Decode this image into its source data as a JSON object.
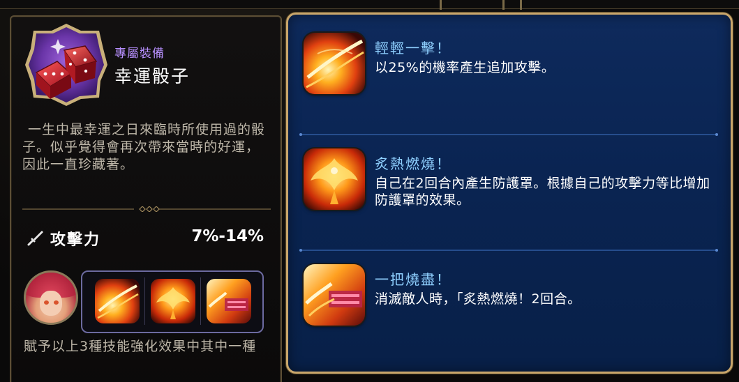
{
  "equipment": {
    "type_label": "專屬裝備",
    "name": "幸運骰子",
    "icon": "dice-icon",
    "description": "一生中最幸運之日來臨時所使用過的骰子。似乎覺得會再次帶來當時的好運，因此一直珍藏著。",
    "stat": {
      "icon": "sword-icon",
      "label": "攻擊力",
      "value": "7%-14%"
    },
    "bonus_note": "賦予以上3種技能強化效果中其中一種"
  },
  "skills": [
    {
      "name": "輕輕一擊！",
      "description": "以25%的機率產生追加攻擊。",
      "icon": "fire-slash-icon"
    },
    {
      "name": "炙熱燃燒！",
      "description": "自己在2回合內產生防護罩。根據自己的攻擊力等比增加防護罩的效果。",
      "icon": "fire-phoenix-icon"
    },
    {
      "name": "一把燒盡！",
      "description": "消滅敵人時，「炙熱燃燒！2回合。",
      "icon": "fire-burst-icon"
    }
  ],
  "colors": {
    "skill_name": "#8fd0ff",
    "equip_type": "#b890ff",
    "panel_blue": "#0a2452",
    "gold_border": "#c9a66b"
  }
}
